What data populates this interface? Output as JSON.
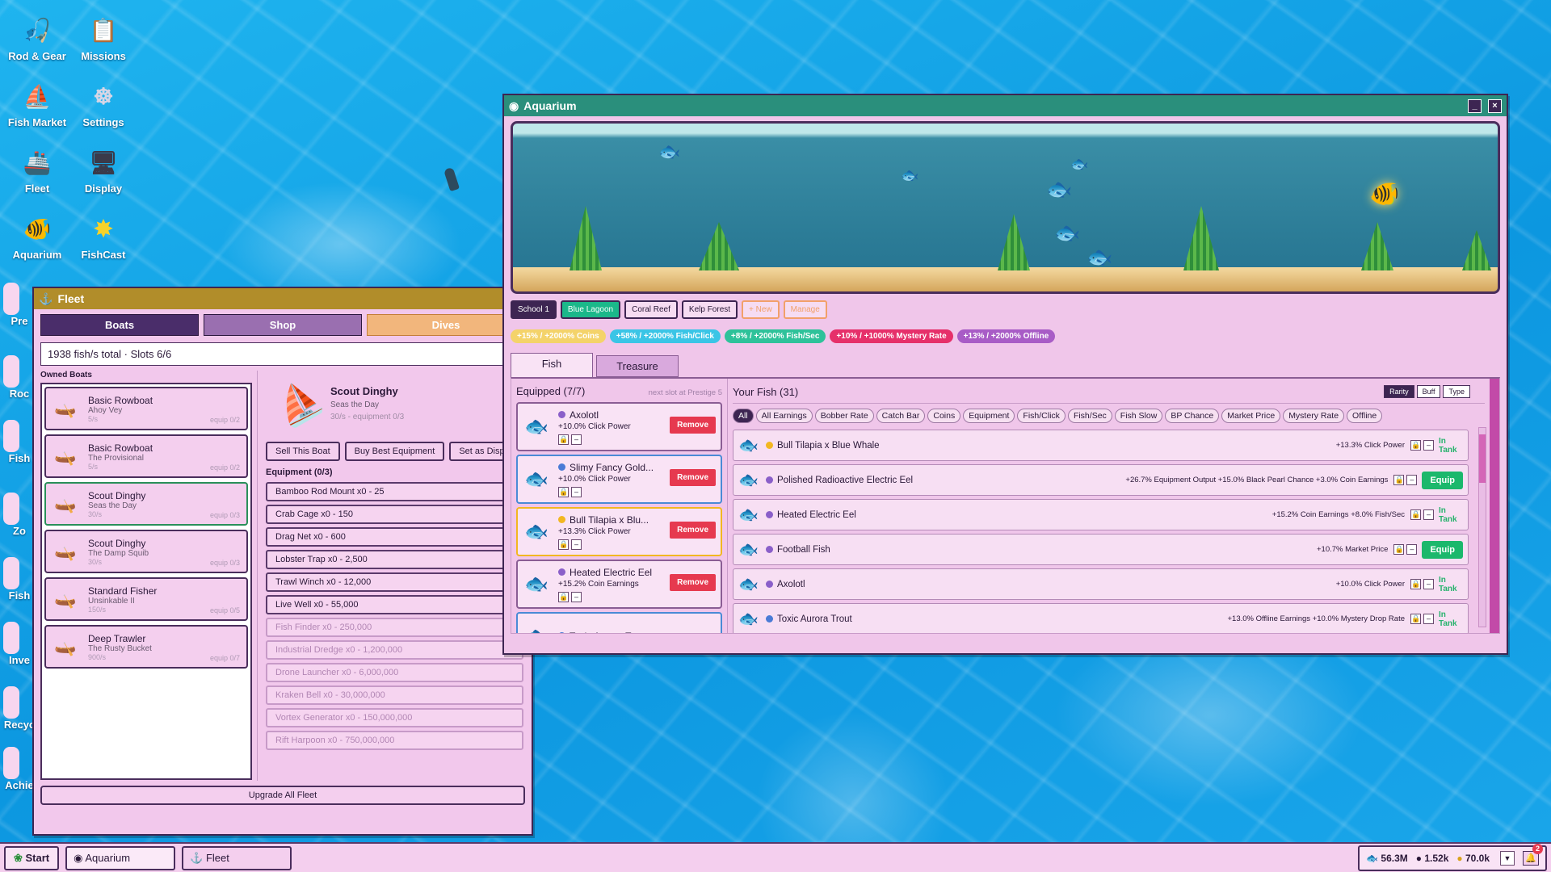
{
  "desktop": {
    "icons": [
      {
        "label": "Rod & Gear",
        "icon": "fishing-rod-icon"
      },
      {
        "label": "Missions",
        "icon": "clipboard-icon"
      },
      {
        "label": "Fish Market",
        "icon": "market-icon"
      },
      {
        "label": "Settings",
        "icon": "ship-wheel-icon"
      },
      {
        "label": "Fleet",
        "icon": "ship-icon"
      },
      {
        "label": "Display",
        "icon": "monitor-icon"
      },
      {
        "label": "Aquarium",
        "icon": "fishbowl-icon"
      },
      {
        "label": "FishCast",
        "icon": "sun-icon"
      }
    ],
    "partial_labels": [
      "Pre",
      "Roc",
      "Fish",
      "Zo",
      "Fish",
      "Inve",
      "Recyc",
      "Achie"
    ]
  },
  "aquarium": {
    "title": "Aquarium",
    "schools": [
      "School 1",
      "Blue Lagoon",
      "Coral Reef",
      "Kelp Forest",
      "+ New",
      "Manage"
    ],
    "bonuses": [
      "+15% / +2000% Coins",
      "+58% / +2000% Fish/Click",
      "+8% / +2000% Fish/Sec",
      "+10% / +1000% Mystery Rate",
      "+13% / +2000% Offline"
    ],
    "tabs": [
      "Fish",
      "Treasure"
    ],
    "equipped_title": "Equipped (7/7)",
    "next_slot": "next slot at Prestige 5",
    "equipped": [
      {
        "name": "Axolotl",
        "buff": "+10.0% Click Power",
        "remove": "Remove",
        "color": "#8a5fc9"
      },
      {
        "name": "Slimy Fancy Gold...",
        "buff": "+10.0% Click Power",
        "remove": "Remove",
        "color": "#4a7bd6"
      },
      {
        "name": "Bull Tilapia x Blu...",
        "buff": "+13.3% Click Power",
        "remove": "Remove",
        "color": "#f2b721"
      },
      {
        "name": "Heated Electric Eel",
        "buff": "+15.2% Coin Earnings",
        "remove": "Remove",
        "color": "#8a5fc9"
      },
      {
        "name": "Toxic Aurora Trout",
        "buff": "",
        "remove": "",
        "color": "#4a7bd6"
      }
    ],
    "your_fish_title": "Your Fish (31)",
    "sort": [
      "Rarity",
      "Buff",
      "Type"
    ],
    "filters": [
      "All",
      "All Earnings",
      "Bobber Rate",
      "Catch Bar",
      "Coins",
      "Equipment",
      "Fish/Click",
      "Fish/Sec",
      "Fish Slow",
      "BP Chance",
      "Market Price",
      "Mystery Rate",
      "Offline"
    ],
    "fish": [
      {
        "name": "Bull Tilapia x Blue Whale",
        "buff": "+13.3% Click Power",
        "status": "In Tank",
        "color": "#f2b721"
      },
      {
        "name": "Polished Radioactive Electric Eel",
        "buff": "+26.7% Equipment Output +15.0% Black Pearl Chance +3.0% Coin Earnings",
        "status": "Equip",
        "color": "#8a5fc9"
      },
      {
        "name": "Heated Electric Eel",
        "buff": "+15.2% Coin Earnings +8.0% Fish/Sec",
        "status": "In Tank",
        "color": "#8a5fc9"
      },
      {
        "name": "Football Fish",
        "buff": "+10.7% Market Price",
        "status": "Equip",
        "color": "#8a5fc9"
      },
      {
        "name": "Axolotl",
        "buff": "+10.0% Click Power",
        "status": "In Tank",
        "color": "#8a5fc9"
      },
      {
        "name": "Toxic Aurora Trout",
        "buff": "+13.0% Offline Earnings +10.0% Mystery Drop Rate",
        "status": "In Tank",
        "color": "#4a7bd6"
      }
    ]
  },
  "fleet": {
    "title": "Fleet",
    "tabs": [
      "Boats",
      "Shop",
      "Dives"
    ],
    "summary": "1938 fish/s total · Slots 6/6",
    "owned_label": "Owned Boats",
    "boats": [
      {
        "type": "Basic Rowboat",
        "name": "Ahoy Vey",
        "rate": "5/s",
        "equip": "equip 0/2"
      },
      {
        "type": "Basic Rowboat",
        "name": "The Provisional",
        "rate": "5/s",
        "equip": "equip 0/2"
      },
      {
        "type": "Scout Dinghy",
        "name": "Seas the Day",
        "rate": "30/s",
        "equip": "equip 0/3"
      },
      {
        "type": "Scout Dinghy",
        "name": "The Damp Squib",
        "rate": "30/s",
        "equip": "equip 0/3"
      },
      {
        "type": "Standard Fisher",
        "name": "Unsinkable II",
        "rate": "150/s",
        "equip": "equip 0/5"
      },
      {
        "type": "Deep Trawler",
        "name": "The Rusty Bucket",
        "rate": "900/s",
        "equip": "equip 0/7"
      }
    ],
    "selected": {
      "type": "Scout Dinghy",
      "name": "Seas the Day",
      "stats": "30/s - equipment 0/3"
    },
    "actions": [
      "Sell This Boat",
      "Buy Best Equipment",
      "Set as Disp"
    ],
    "equip_title": "Equipment (0/3)",
    "equipment": [
      "Bamboo Rod Mount x0 - 25",
      "Crab Cage x0 - 150",
      "Drag Net x0 - 600",
      "Lobster Trap x0 - 2,500",
      "Trawl Winch x0 - 12,000",
      "Live Well x0 - 55,000",
      "Fish Finder x0 - 250,000",
      "Industrial Dredge x0 - 1,200,000",
      "Drone Launcher x0 - 6,000,000",
      "Kraken Bell x0 - 30,000,000",
      "Vortex Generator x0 - 150,000,000",
      "Rift Harpoon x0 - 750,000,000"
    ],
    "upgrade": "Upgrade All Fleet"
  },
  "taskbar": {
    "start": "Start",
    "windows": [
      "Aquarium",
      "Fleet"
    ],
    "stat1": "56.3M",
    "stat2": "1.52k",
    "stat3": "70.0k",
    "notif": "2"
  }
}
